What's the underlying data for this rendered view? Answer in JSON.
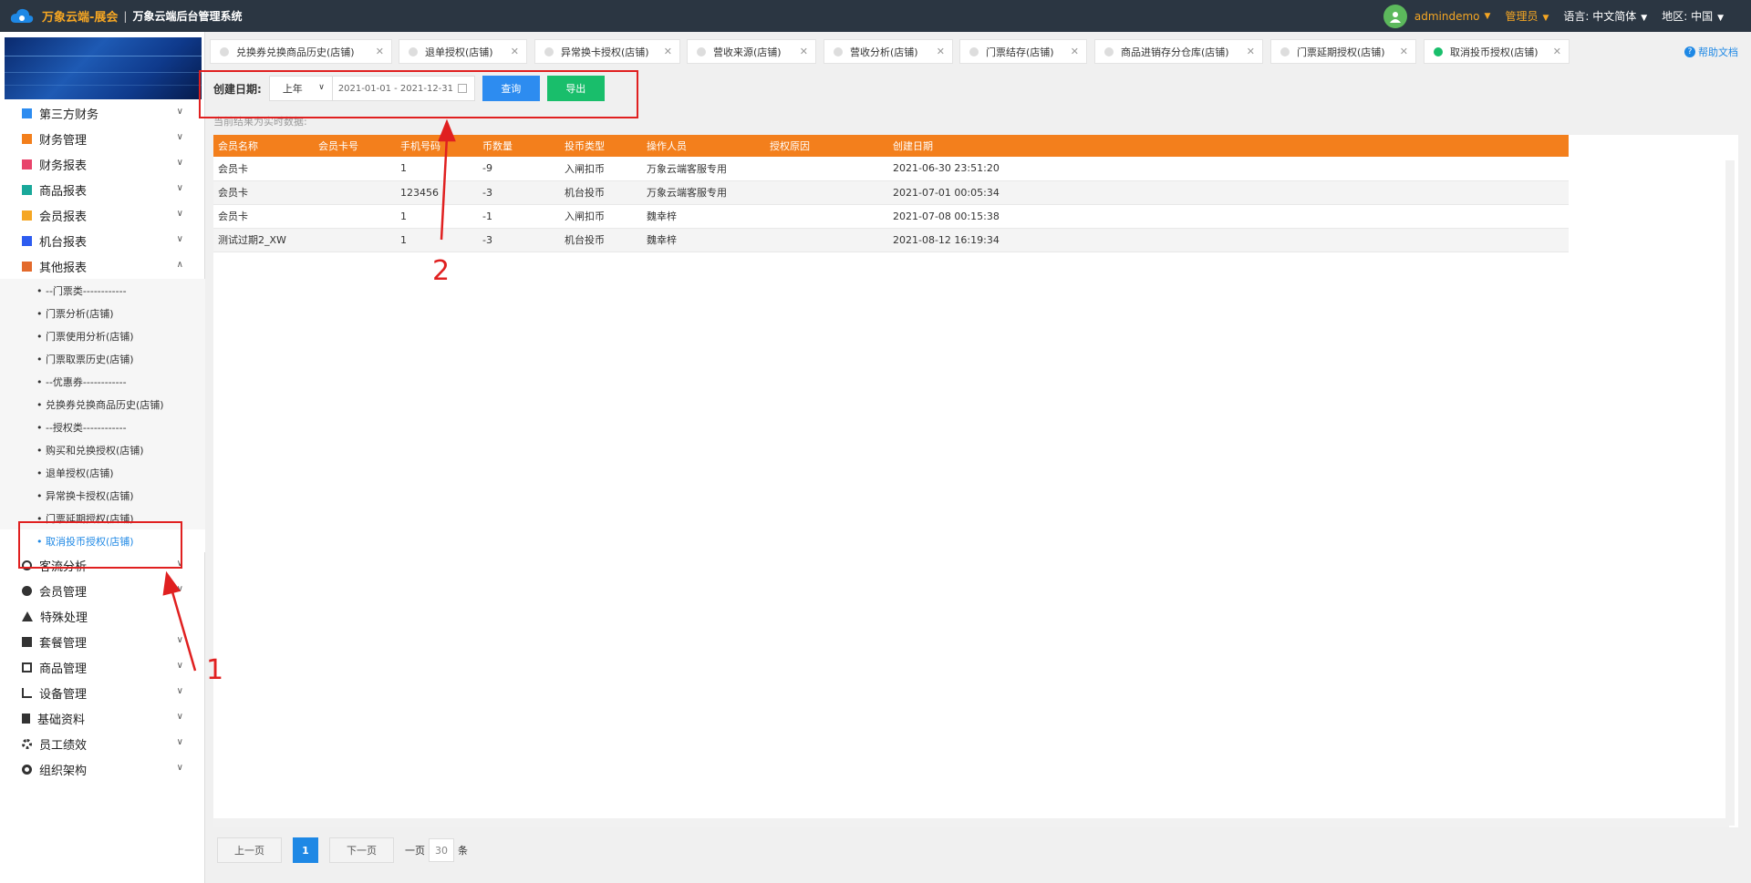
{
  "header": {
    "brand": "万象云端-展会",
    "separator": "|",
    "subtitle": "万象云端后台管理系统",
    "user": "admindemo",
    "role": "管理员",
    "language_label": "语言:",
    "language_value": "中文简体",
    "region_label": "地区:",
    "region_value": "中国"
  },
  "sidebar": {
    "items": [
      {
        "label": "第三方财务"
      },
      {
        "label": "财务管理"
      },
      {
        "label": "财务报表"
      },
      {
        "label": "商品报表"
      },
      {
        "label": "会员报表"
      },
      {
        "label": "机台报表"
      },
      {
        "label": "其他报表"
      }
    ],
    "subitems": [
      "• --门票类------------",
      "• 门票分析(店铺)",
      "• 门票使用分析(店铺)",
      "• 门票取票历史(店铺)",
      "• --优惠券------------",
      "• 兑换券兑换商品历史(店铺)",
      "• --授权类------------",
      "• 购买和兑换授权(店铺)",
      "• 退单授权(店铺)",
      "• 异常换卡授权(店铺)",
      "• 门票延期授权(店铺)",
      "• 取消投币授权(店铺)"
    ],
    "items_after": [
      {
        "label": "客流分析"
      },
      {
        "label": "会员管理"
      },
      {
        "label": "特殊处理"
      },
      {
        "label": "套餐管理"
      },
      {
        "label": "商品管理"
      },
      {
        "label": "设备管理"
      },
      {
        "label": "基础资料"
      },
      {
        "label": "员工绩效"
      },
      {
        "label": "组织架构"
      }
    ]
  },
  "tabs": [
    "兑换券兑换商品历史(店铺)",
    "退单授权(店铺)",
    "异常换卡授权(店铺)",
    "营收来源(店铺)",
    "营收分析(店铺)",
    "门票结存(店铺)",
    "商品进销存分仓库(店铺)",
    "门票延期授权(店铺)",
    "取消投币授权(店铺)"
  ],
  "help_label": "帮助文档",
  "filter": {
    "label": "创建日期:",
    "period": "上年",
    "date_range": "2021-01-01 - 2021-12-31",
    "query_btn": "查询",
    "export_btn": "导出"
  },
  "note": "当前结果为实时数据:",
  "table": {
    "headers": [
      "会员名称",
      "会员卡号",
      "手机号码",
      "币数量",
      "投币类型",
      "操作人员",
      "授权原因",
      "创建日期"
    ],
    "rows": [
      [
        "会员卡",
        "",
        "1",
        "-9",
        "入闸扣币",
        "万象云端客服专用",
        "",
        "2021-06-30 23:51:20"
      ],
      [
        "会员卡",
        "",
        "123456",
        "-3",
        "机台投币",
        "万象云端客服专用",
        "",
        "2021-07-01 00:05:34"
      ],
      [
        "会员卡",
        "",
        "1",
        "-1",
        "入闸扣币",
        "魏幸梓",
        "",
        "2021-07-08 00:15:38"
      ],
      [
        "测试过期2_XW",
        "",
        "1",
        "-3",
        "机台投币",
        "魏幸梓",
        "",
        "2021-08-12 16:19:34"
      ]
    ]
  },
  "pager": {
    "prev": "上一页",
    "page": "1",
    "next": "下一页",
    "per_page_label": "一页",
    "per_page": "30",
    "unit": "条"
  },
  "annotations": {
    "one": "1",
    "two": "2",
    "color": "#e02020"
  }
}
